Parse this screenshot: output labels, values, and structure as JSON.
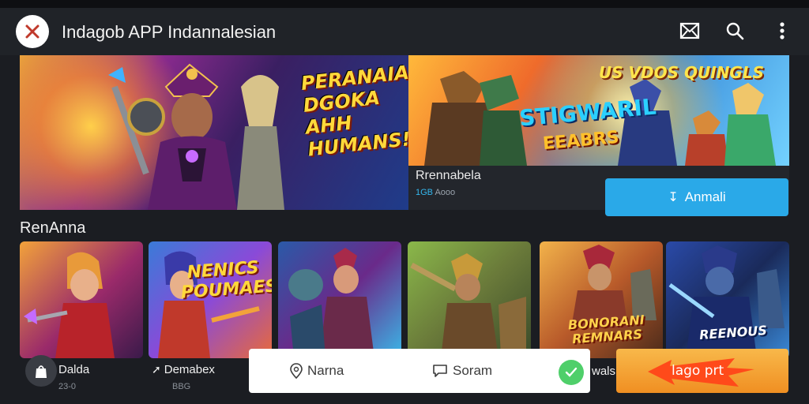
{
  "app": {
    "title": "Indagob APP Indannalesian"
  },
  "hero": {
    "left_headline": "PERANAIA DGOKA AHH HUMANS!",
    "right_top_text": "US VDOS QUINGLS",
    "right_title": "STIGWARIL",
    "right_subtitle": "EEABRS",
    "game_name": "Rrennabela",
    "game_meta_accent": "1GB",
    "game_meta": "Aooo",
    "install_label": "Anmali"
  },
  "section": {
    "title": "RenAnna"
  },
  "cards": [
    {
      "label": "Dalda",
      "meta": "23-0",
      "art_text": ""
    },
    {
      "label": "Demabex",
      "meta": "BBG",
      "art_text": "NENICS POUMAES"
    },
    {
      "label": "",
      "meta": "",
      "art_text": ""
    },
    {
      "label": "",
      "meta": "",
      "art_text": ""
    },
    {
      "label": "",
      "meta": "",
      "art_text": "BONORANI REMNARS"
    },
    {
      "label": "",
      "meta": "",
      "art_text": "REENOUS"
    }
  ],
  "bottom_bar": {
    "item1": "Narna",
    "item2": "Soram"
  },
  "side_label": "wals",
  "promo": {
    "label": "lago prt"
  },
  "colors": {
    "accent_blue": "#2aa9e8",
    "promo_orange": "#f08f22",
    "check_green": "#4fcf6a"
  }
}
